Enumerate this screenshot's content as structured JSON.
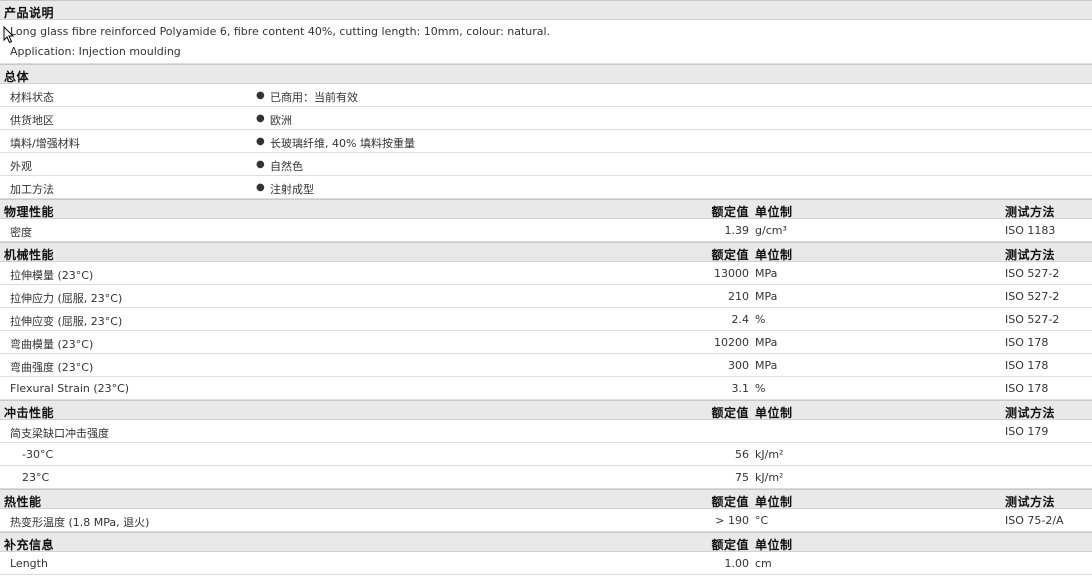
{
  "description": {
    "header": "产品说明",
    "line1": "Long glass fibre reinforced Polyamide 6, fibre content 40%, cutting length: 10mm, colour: natural.",
    "line2": "Application: Injection moulding"
  },
  "general": {
    "header": "总体",
    "rows": [
      {
        "label": "材料状态",
        "value": "已商用：当前有效"
      },
      {
        "label": "供货地区",
        "value": "欧洲"
      },
      {
        "label": "填料/增强材料",
        "value": "长玻璃纤维, 40% 填料按重量"
      },
      {
        "label": "外观",
        "value": "自然色"
      },
      {
        "label": "加工方法",
        "value": "注射成型"
      }
    ]
  },
  "columns": {
    "nominal": "额定值",
    "unit": "单位制",
    "method": "测试方法"
  },
  "physical": {
    "header": "物理性能",
    "rows": [
      {
        "label": "密度",
        "nominal": "1.39",
        "unit": "g/cm³",
        "method": "ISO 1183"
      }
    ]
  },
  "mechanical": {
    "header": "机械性能",
    "rows": [
      {
        "label": "拉伸模量 (23°C)",
        "nominal": "13000",
        "unit": "MPa",
        "method": "ISO 527-2"
      },
      {
        "label": "拉伸应力 (屈服, 23°C)",
        "nominal": "210",
        "unit": "MPa",
        "method": "ISO 527-2"
      },
      {
        "label": "拉伸应变 (屈服, 23°C)",
        "nominal": "2.4",
        "unit": "%",
        "method": "ISO 527-2"
      },
      {
        "label": "弯曲模量 (23°C)",
        "nominal": "10200",
        "unit": "MPa",
        "method": "ISO 178"
      },
      {
        "label": "弯曲强度 (23°C)",
        "nominal": "300",
        "unit": "MPa",
        "method": "ISO 178"
      },
      {
        "label": "Flexural Strain (23°C)",
        "nominal": "3.1",
        "unit": "%",
        "method": "ISO 178"
      }
    ]
  },
  "impact": {
    "header": "冲击性能",
    "rows": [
      {
        "label": "简支梁缺口冲击强度",
        "nominal": "",
        "unit": "",
        "method": "ISO 179",
        "sub": false
      },
      {
        "label": "-30°C",
        "nominal": "56",
        "unit": "kJ/m²",
        "method": "",
        "sub": true
      },
      {
        "label": "23°C",
        "nominal": "75",
        "unit": "kJ/m²",
        "method": "",
        "sub": true
      }
    ]
  },
  "thermal": {
    "header": "热性能",
    "rows": [
      {
        "label": "热变形温度 (1.8 MPa, 退火)",
        "nominal": "> 190",
        "unit": "°C",
        "method": "ISO 75-2/A"
      }
    ]
  },
  "supplementary": {
    "header": "补充信息",
    "rows": [
      {
        "label": "Length",
        "nominal": "1.00",
        "unit": "cm",
        "method": ""
      }
    ]
  },
  "bullet": "●"
}
